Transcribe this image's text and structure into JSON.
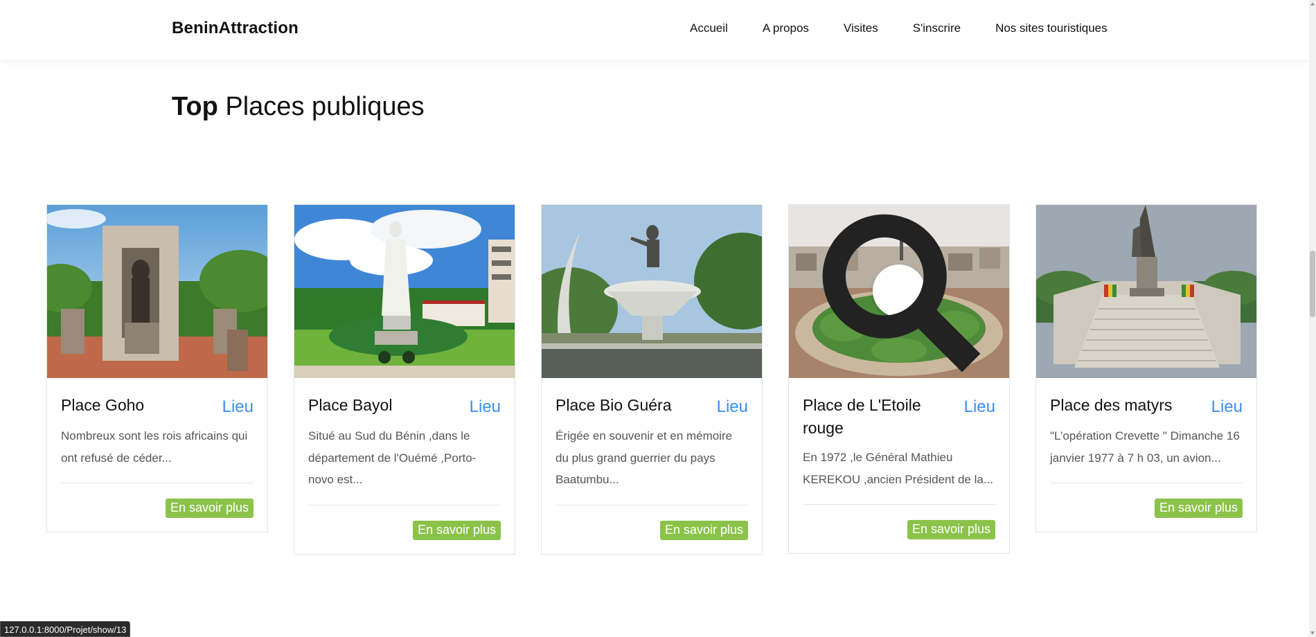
{
  "navbar": {
    "brand": "BeninAttraction",
    "items": [
      "Accueil",
      "A propos",
      "Visites",
      "S'inscrire",
      "Nos sites touristiques"
    ]
  },
  "section": {
    "title_bold": "Top",
    "title_rest": " Places publiques"
  },
  "cards": [
    {
      "title": "Place Goho",
      "tag": "Lieu",
      "description": "Nombreux sont les rois africains qui ont refusé de céder...",
      "button": "En savoir plus"
    },
    {
      "title": "Place Bayol",
      "tag": "Lieu",
      "description": "Situé au Sud du Bénin ,dans le département de l'Ouémé ,Porto-novo est...",
      "button": "En savoir plus"
    },
    {
      "title": "Place Bio Guéra",
      "tag": "Lieu",
      "description": "Érigée en souvenir et en mémoire du plus grand guerrier du pays Baatumbu...",
      "button": "En savoir plus"
    },
    {
      "title": "Place de L'Etoile rouge",
      "tag": "Lieu",
      "description": "En 1972 ,le Général Mathieu KEREKOU ,ancien Président de la...",
      "button": "En savoir plus"
    },
    {
      "title": "Place des matyrs",
      "tag": "Lieu",
      "description": "\"L’opération Crevette \" Dimanche 16 janvier 1977 à 7 h 03, un avion...",
      "button": "En savoir plus"
    }
  ],
  "statusbar": {
    "url": "127.0.0.1:8000/Projet/show/13"
  },
  "colors": {
    "accent_blue": "#3a8ef0",
    "button_green": "#8bc34a"
  },
  "icons": {
    "zoom": "search-icon"
  }
}
